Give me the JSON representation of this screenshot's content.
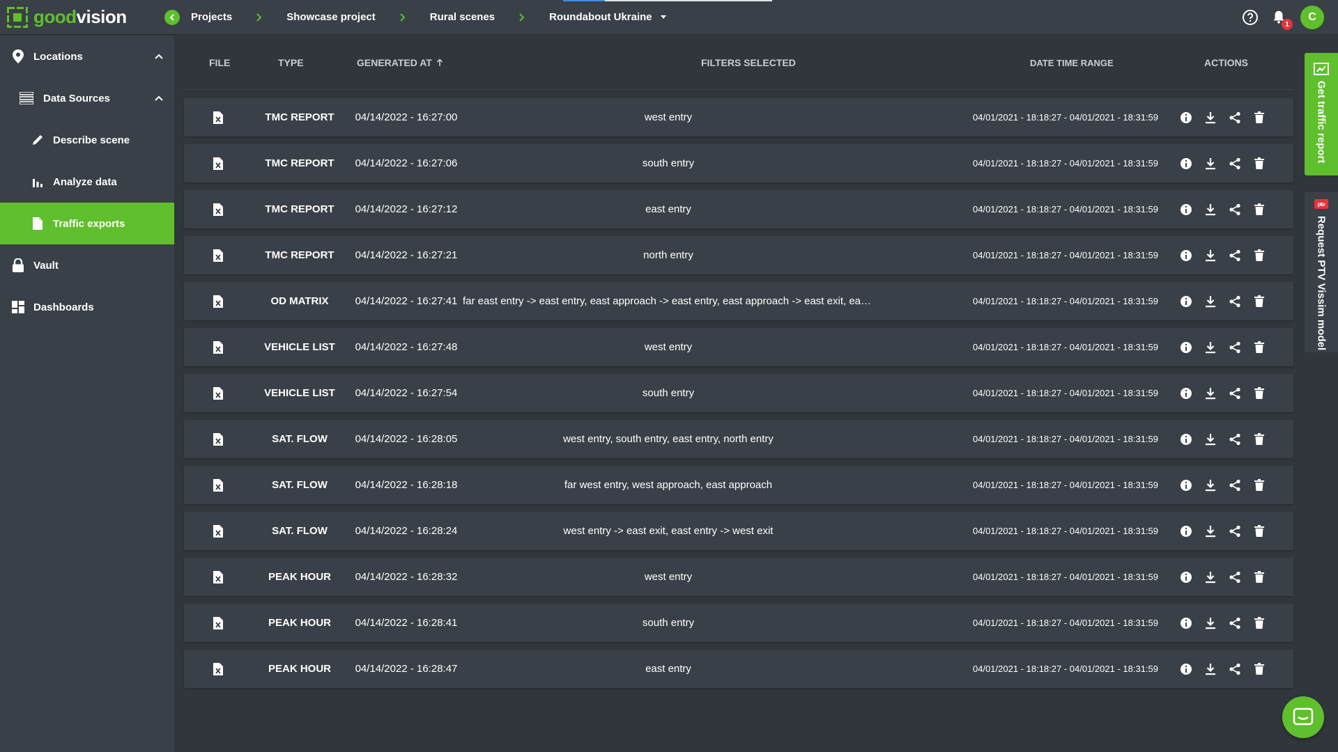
{
  "app": {
    "logo_part1": "good",
    "logo_part2": "vision"
  },
  "breadcrumbs": [
    {
      "label": "Projects"
    },
    {
      "label": "Showcase project"
    },
    {
      "label": "Rural scenes"
    },
    {
      "label": "Roundabout Ukraine"
    }
  ],
  "header": {
    "notifications_count": "1",
    "avatar_initial": "C"
  },
  "sidebar": {
    "items": [
      {
        "label": "Locations",
        "icon": "location-pin-icon"
      },
      {
        "label": "Data Sources",
        "icon": "data-sources-icon"
      },
      {
        "label": "Describe scene",
        "icon": "pencil-icon"
      },
      {
        "label": "Analyze data",
        "icon": "bar-chart-icon"
      },
      {
        "label": "Traffic exports",
        "icon": "document-icon"
      },
      {
        "label": "Vault",
        "icon": "lock-icon"
      },
      {
        "label": "Dashboards",
        "icon": "dashboard-icon"
      }
    ]
  },
  "table": {
    "headers": {
      "file": "FILE",
      "type": "TYPE",
      "generated_at": "GENERATED AT",
      "filters": "FILTERS SELECTED",
      "date_time_range": "DATE TIME RANGE",
      "actions": "ACTIONS"
    },
    "rows": [
      {
        "type": "TMC REPORT",
        "generated": "04/14/2022 - 16:27:00",
        "filters": "west entry",
        "range": "04/01/2021 - 18:18:27 - 04/01/2021 - 18:31:59"
      },
      {
        "type": "TMC REPORT",
        "generated": "04/14/2022 - 16:27:06",
        "filters": "south entry",
        "range": "04/01/2021 - 18:18:27 - 04/01/2021 - 18:31:59"
      },
      {
        "type": "TMC REPORT",
        "generated": "04/14/2022 - 16:27:12",
        "filters": "east entry",
        "range": "04/01/2021 - 18:18:27 - 04/01/2021 - 18:31:59"
      },
      {
        "type": "TMC REPORT",
        "generated": "04/14/2022 - 16:27:21",
        "filters": "north entry",
        "range": "04/01/2021 - 18:18:27 - 04/01/2021 - 18:31:59"
      },
      {
        "type": "OD MATRIX",
        "generated": "04/14/2022 - 16:27:41",
        "filters": "far east entry -> east entry, east approach -> east entry, east approach -> east exit, east approach -> far ...",
        "range": "04/01/2021 - 18:18:27 - 04/01/2021 - 18:31:59"
      },
      {
        "type": "VEHICLE LIST",
        "generated": "04/14/2022 - 16:27:48",
        "filters": "west entry",
        "range": "04/01/2021 - 18:18:27 - 04/01/2021 - 18:31:59"
      },
      {
        "type": "VEHICLE LIST",
        "generated": "04/14/2022 - 16:27:54",
        "filters": "south entry",
        "range": "04/01/2021 - 18:18:27 - 04/01/2021 - 18:31:59"
      },
      {
        "type": "SAT. FLOW",
        "generated": "04/14/2022 - 16:28:05",
        "filters": "west entry, south entry, east entry, north entry",
        "range": "04/01/2021 - 18:18:27 - 04/01/2021 - 18:31:59"
      },
      {
        "type": "SAT. FLOW",
        "generated": "04/14/2022 - 16:28:18",
        "filters": "far west entry, west approach, east approach",
        "range": "04/01/2021 - 18:18:27 - 04/01/2021 - 18:31:59"
      },
      {
        "type": "SAT. FLOW",
        "generated": "04/14/2022 - 16:28:24",
        "filters": "west entry -> east exit, east entry -> west exit",
        "range": "04/01/2021 - 18:18:27 - 04/01/2021 - 18:31:59"
      },
      {
        "type": "PEAK HOUR",
        "generated": "04/14/2022 - 16:28:32",
        "filters": "west entry",
        "range": "04/01/2021 - 18:18:27 - 04/01/2021 - 18:31:59"
      },
      {
        "type": "PEAK HOUR",
        "generated": "04/14/2022 - 16:28:41",
        "filters": "south entry",
        "range": "04/01/2021 - 18:18:27 - 04/01/2021 - 18:31:59"
      },
      {
        "type": "PEAK HOUR",
        "generated": "04/14/2022 - 16:28:47",
        "filters": "east entry",
        "range": "04/01/2021 - 18:18:27 - 04/01/2021 - 18:31:59"
      }
    ]
  },
  "side_tabs": {
    "traffic_report": "Get traffic report",
    "ptv": "Request PTV Vissim model",
    "ptv_badge": "ptv"
  },
  "colors": {
    "accent": "#5fbf2c",
    "background": "#31363c",
    "panel": "#3a4047",
    "alert": "#e3343a"
  }
}
